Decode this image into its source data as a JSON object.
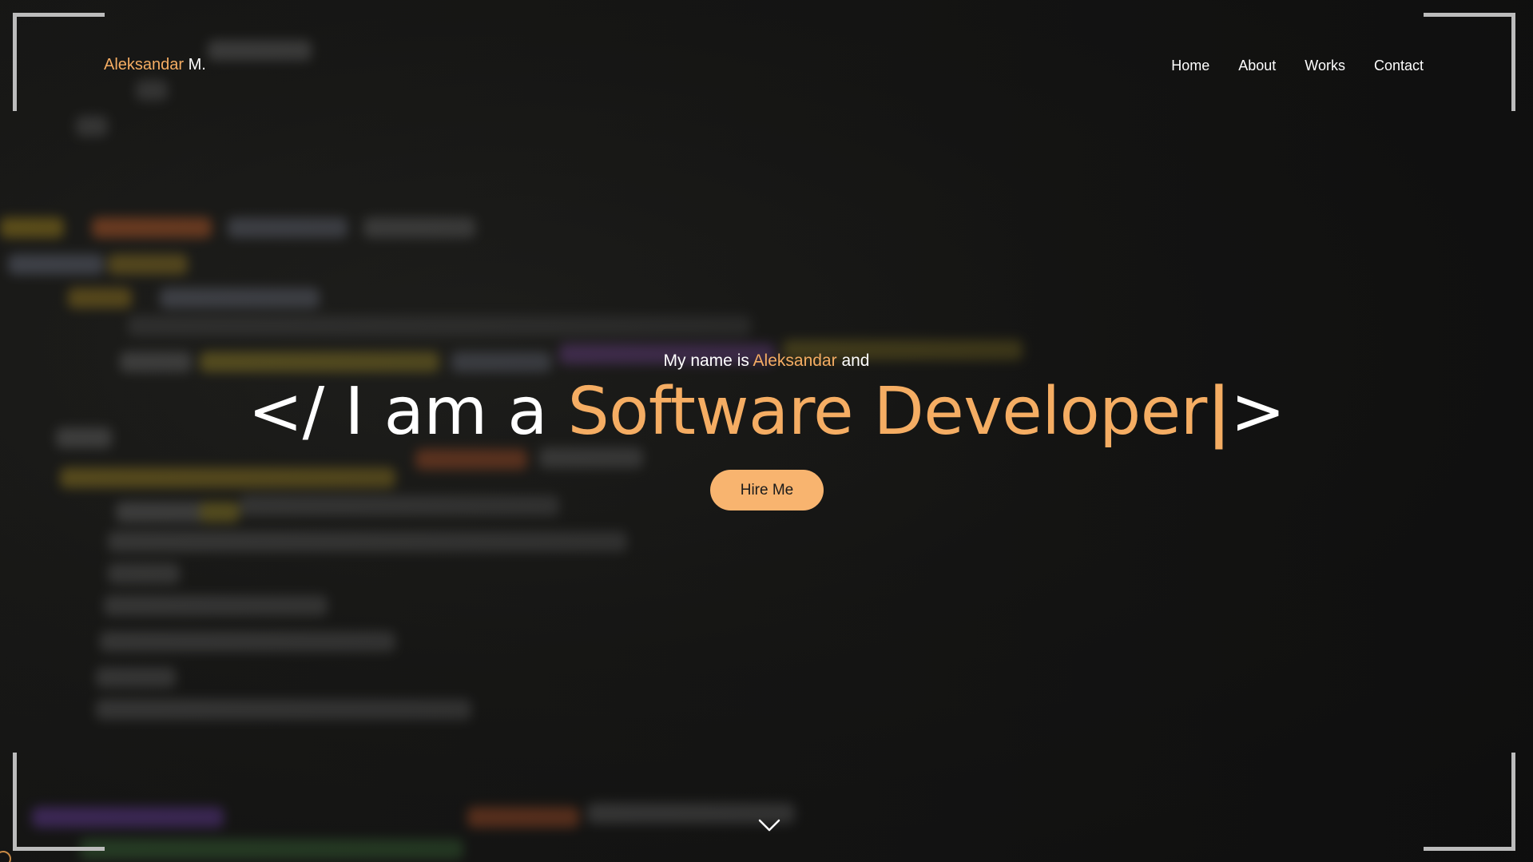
{
  "brand": {
    "first": "Aleksandar",
    "last": "M."
  },
  "nav": {
    "items": [
      "Home",
      "About",
      "Works",
      "Contact"
    ]
  },
  "hero": {
    "intro_prefix": "My name is",
    "intro_name": "Aleksandar",
    "intro_suffix": "and",
    "headline_open": "</ I am a",
    "headline_role": "Software Developer",
    "headline_cursor": "|",
    "headline_close": ">",
    "cta_label": "Hire Me"
  },
  "icons": {
    "scroll": "chevron-down-icon"
  },
  "colors": {
    "accent": "#f5ad63",
    "button": "#f8b46f",
    "text": "#ffffff",
    "background": "#161616",
    "frame": "#bcbcbc"
  }
}
